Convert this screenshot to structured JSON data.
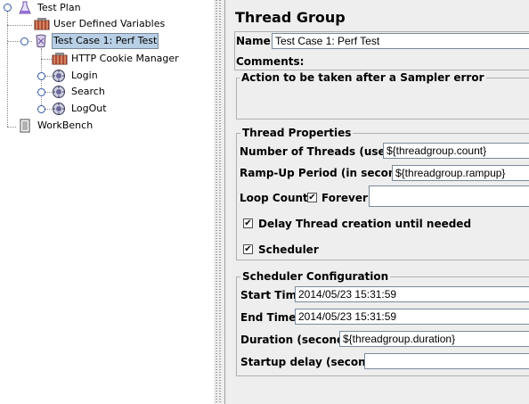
{
  "tree": {
    "items": [
      {
        "label": "Test Plan",
        "icon": "test-plan-icon"
      },
      {
        "label": "User Defined Variables",
        "icon": "variables-icon"
      },
      {
        "label": "Test Case 1: Perf Test",
        "icon": "thread-group-icon"
      },
      {
        "label": "HTTP Cookie Manager",
        "icon": "cookie-manager-icon"
      },
      {
        "label": "Login",
        "icon": "controller-icon"
      },
      {
        "label": "Search",
        "icon": "controller-icon"
      },
      {
        "label": "LogOut",
        "icon": "controller-icon"
      },
      {
        "label": "WorkBench",
        "icon": "workbench-icon"
      }
    ]
  },
  "panel": {
    "title": "Thread Group",
    "name_label": "Name:",
    "name_value": "Test Case 1: Perf Test",
    "comments_label": "Comments:",
    "action_legend": "Action to be taken after a Sampler error",
    "thread_props": {
      "legend": "Thread Properties",
      "threads_label": "Number of Threads (users):",
      "threads_value": "${threadgroup.count}",
      "rampup_label": "Ramp-Up Period (in seconds):",
      "rampup_value": "${threadgroup.rampup}",
      "loop_label": "Loop Count:",
      "forever_label": "Forever",
      "forever_checked": true,
      "loop_value": "",
      "delay_label": "Delay Thread creation until needed",
      "delay_checked": true,
      "scheduler_label": "Scheduler",
      "scheduler_checked": true
    },
    "scheduler_config": {
      "legend": "Scheduler Configuration",
      "start_label": "Start Time",
      "start_value": "2014/05/23 15:31:59",
      "end_label": "End Time",
      "end_value": "2014/05/23 15:31:59",
      "duration_label": "Duration (seconds)",
      "duration_value": "${threadgroup.duration}",
      "startup_label": "Startup delay (seconds)",
      "startup_value": ""
    }
  }
}
